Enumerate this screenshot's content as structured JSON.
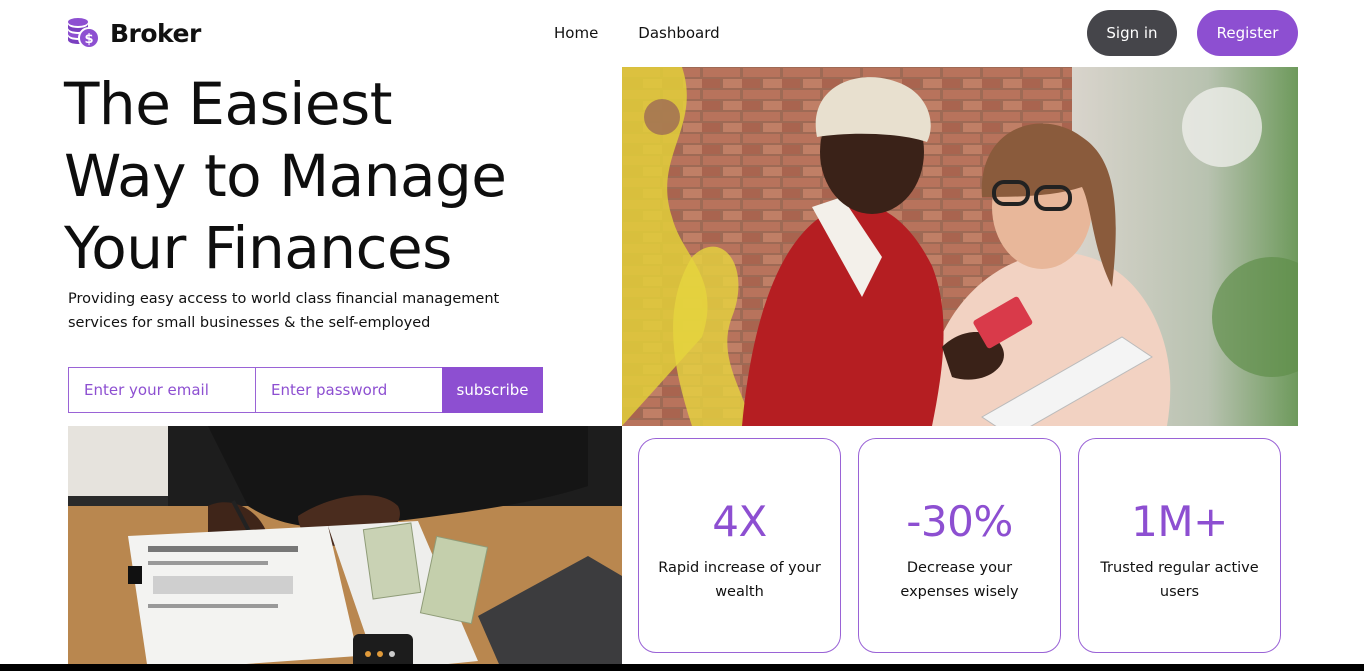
{
  "brand": {
    "name": "Broker",
    "icon": "coins-dollar-icon",
    "accent": "#8d4fd1"
  },
  "nav": {
    "items": [
      "Home",
      "Dashboard"
    ]
  },
  "auth": {
    "signin_label": "Sign in",
    "register_label": "Register"
  },
  "hero": {
    "title_lines": [
      "The Easiest",
      "Way to Manage",
      "Your Finances"
    ],
    "subtitle": "Providing easy access to world class financial management services for small businesses & the self-employed"
  },
  "form": {
    "email_placeholder": "Enter your email",
    "password_placeholder": "Enter password",
    "submit_label": "subscribe"
  },
  "stats": [
    {
      "value": "4X",
      "label": "Rapid increase of your wealth"
    },
    {
      "value": "-30%",
      "label": "Decrease your expenses wisely"
    },
    {
      "value": "1M+",
      "label": "Trusted regular active users"
    }
  ],
  "colors": {
    "accent": "#8d4fd1",
    "signin_bg": "#45454a",
    "card_border": "#9a63d6"
  }
}
